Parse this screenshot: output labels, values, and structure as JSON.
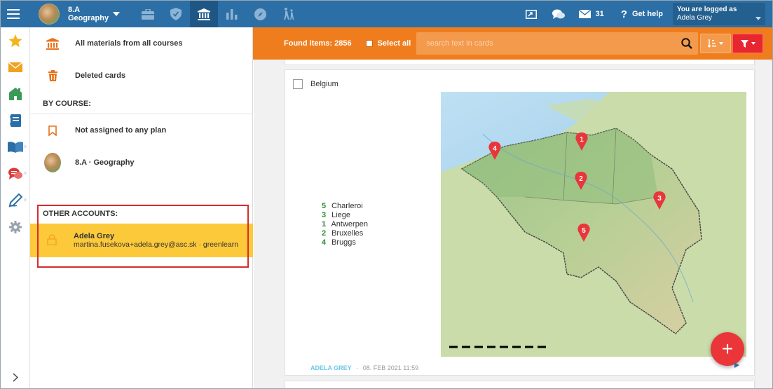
{
  "topbar": {
    "course": {
      "line1": "8.A",
      "line2": "Geography"
    },
    "nav_icons": [
      "briefcase-icon",
      "shield-icon",
      "institution-icon",
      "bar-chart-icon",
      "compass-icon",
      "hikers-icon"
    ],
    "active_nav": "institution-icon",
    "messages_count": "31",
    "help_label": "Get help",
    "logged_label": "You are logged as",
    "logged_user": "Adela Grey"
  },
  "rail": {
    "icons": [
      "star-icon",
      "envelope-icon",
      "home-icon",
      "notebook-icon",
      "open-book-icon",
      "chat-icon",
      "pen-icon",
      "gear-icon"
    ],
    "collapse_icon": "chevron-right-icon",
    "colors": {
      "star": "#f2b51d",
      "envelope": "#f0a21f",
      "home": "#3c9a57",
      "notebook": "#2c6fa6",
      "book": "#2c6fa6",
      "chat": "#d93a3a",
      "pen": "#2c6fa6",
      "gear": "#9aa3ab"
    }
  },
  "side": {
    "all_materials": "All materials from all courses",
    "deleted_cards": "Deleted cards",
    "by_course_heading": "BY COURSE:",
    "not_assigned": "Not assigned to any plan",
    "course_item": "8.A · Geography",
    "other_accounts_heading": "OTHER ACCOUNTS:",
    "account": {
      "name": "Adela Grey",
      "email": "martina.fusekova+adela.grey@asc.sk · greenlearn"
    },
    "highlight_color": "#d62c2c",
    "active_bg": "#fcc93a"
  },
  "searchbar": {
    "found_label": "Found items: 2856",
    "select_all": "Select all",
    "placeholder": "search text in cards",
    "bg_color": "#f07d1d",
    "filter_color": "#e8262f"
  },
  "card": {
    "title": "Belgium",
    "legend": [
      {
        "num": "5",
        "city": "Charleroi"
      },
      {
        "num": "3",
        "city": "Liege"
      },
      {
        "num": "1",
        "city": "Antwerpen"
      },
      {
        "num": "2",
        "city": "Bruxelles"
      },
      {
        "num": "4",
        "city": "Bruggs"
      }
    ],
    "map_markers": [
      "1",
      "2",
      "3",
      "4",
      "5"
    ],
    "author": "ADELA GREY",
    "separator": "·",
    "date": "08. FEB 2021 11:59"
  },
  "fab": {
    "symbol": "+"
  }
}
